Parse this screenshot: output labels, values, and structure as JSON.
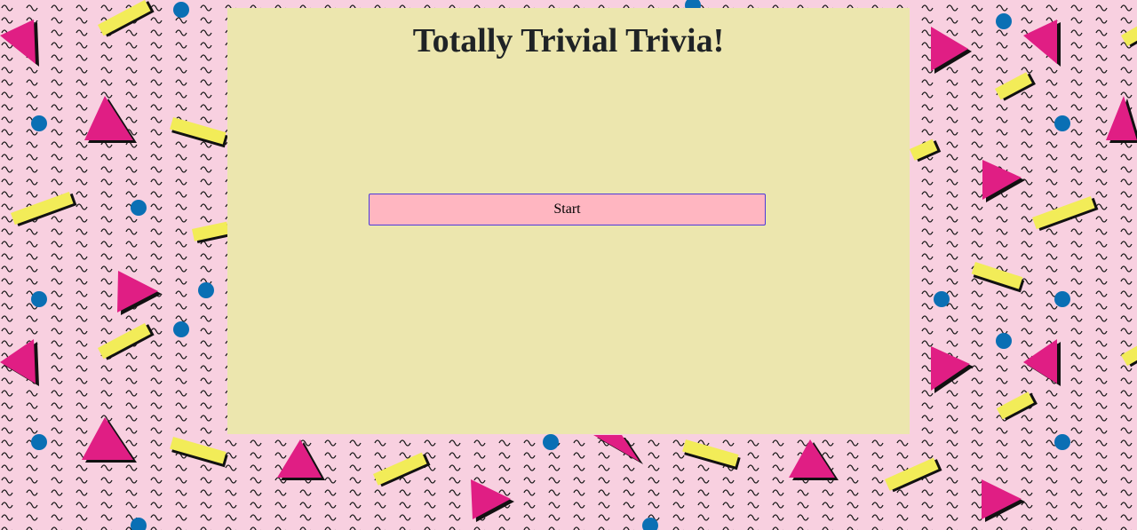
{
  "page": {
    "title": "Totally Trivial Trivia!",
    "start_label": "Start"
  },
  "colors": {
    "background_pink": "#f8d0e0",
    "card": "#ece6ae",
    "button": "#ffb6c1",
    "button_border": "#4b3bd9",
    "title_text": "#1f2326",
    "pattern_triangle": "#e01e84",
    "pattern_bar": "#f2ec58",
    "pattern_dot": "#0a6fb4",
    "pattern_squiggle": "#1a1a1a"
  },
  "background": {
    "icon": "memphis-pattern"
  }
}
